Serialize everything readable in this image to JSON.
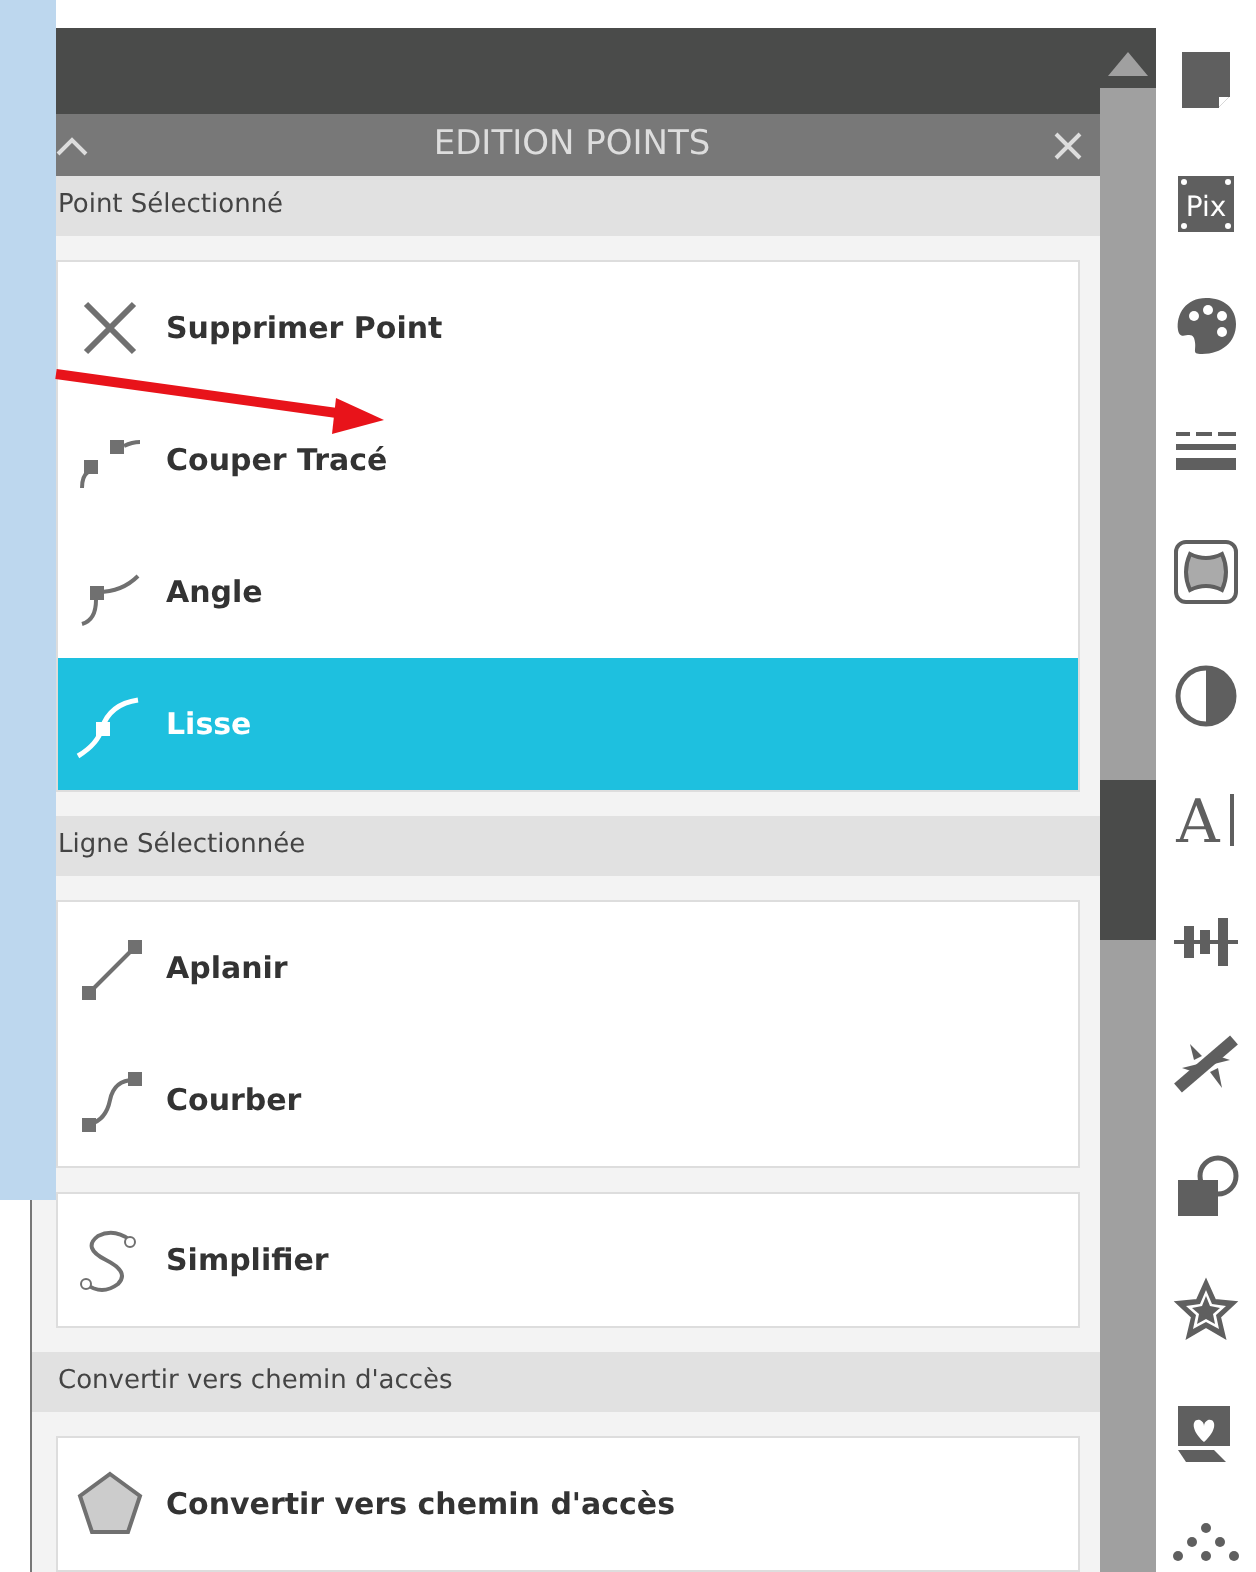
{
  "window": {
    "title": "EDITION POINTS"
  },
  "sections": [
    {
      "title": "Point Sélectionné",
      "groups": [
        {
          "items": [
            {
              "label": "Supprimer Point",
              "kind": "delete",
              "selected": false
            },
            {
              "label": "Couper Tracé",
              "kind": "cut",
              "selected": false
            },
            {
              "label": "Angle",
              "kind": "corner",
              "selected": false
            },
            {
              "label": "Lisse",
              "kind": "smooth",
              "selected": true
            }
          ]
        }
      ]
    },
    {
      "title": "Ligne Sélectionnée",
      "groups": [
        {
          "items": [
            {
              "label": "Aplanir",
              "kind": "flatten",
              "selected": false
            },
            {
              "label": "Courber",
              "kind": "curve",
              "selected": false
            }
          ]
        },
        {
          "items": [
            {
              "label": "Simplifier",
              "kind": "simplify",
              "selected": false
            }
          ]
        }
      ]
    },
    {
      "title": "Convertir vers chemin d'accès",
      "groups": [
        {
          "items": [
            {
              "label": "Convertir vers chemin d'accès",
              "kind": "polygon",
              "selected": false
            }
          ]
        }
      ]
    }
  ],
  "toolbar": [
    {
      "kind": "page"
    },
    {
      "kind": "pix",
      "label": "Pix"
    },
    {
      "kind": "palette"
    },
    {
      "kind": "lines"
    },
    {
      "kind": "shape"
    },
    {
      "kind": "contrast"
    },
    {
      "kind": "text",
      "label": "A"
    },
    {
      "kind": "align"
    },
    {
      "kind": "burst"
    },
    {
      "kind": "shapes"
    },
    {
      "kind": "star"
    },
    {
      "kind": "heart"
    },
    {
      "kind": "dots"
    }
  ]
}
